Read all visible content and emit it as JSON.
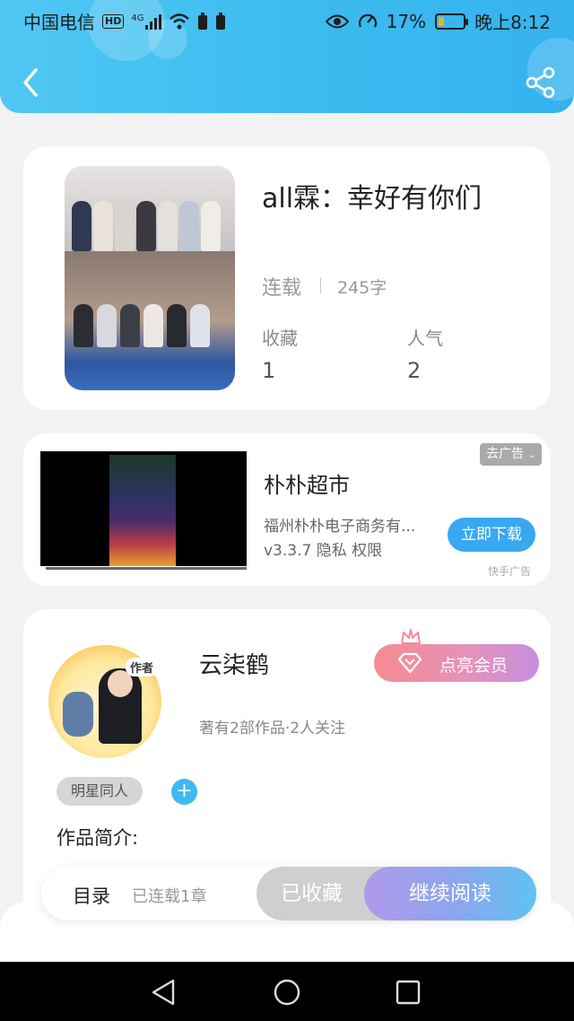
{
  "status_bar": {
    "carrier": "中国电信",
    "hd": "HD",
    "signal": "4G",
    "battery_percent": "17%",
    "time": "晚上8:12"
  },
  "book": {
    "title": "all霖：幸好有你们",
    "status": "连载",
    "word_count": "245字",
    "favorites_label": "收藏",
    "favorites_value": "1",
    "popularity_label": "人气",
    "popularity_value": "2"
  },
  "ad": {
    "close_label": "去广告",
    "title": "朴朴超市",
    "company": "福州朴朴电子商务有...",
    "meta": "v3.3.7  隐私  权限",
    "download_label": "立即下载",
    "source": "快手广告"
  },
  "author": {
    "avatar_tag": "作者",
    "name": "云柒鹤",
    "info": "著有2部作品·2人关注",
    "vip_label": "点亮会员",
    "tag": "明星同人",
    "add_tag": "+",
    "intro_label": "作品简介:"
  },
  "action_bar": {
    "toc_label": "目录",
    "chapters_label": "已连载1章",
    "collected_label": "已收藏",
    "read_label": "继续阅读"
  }
}
